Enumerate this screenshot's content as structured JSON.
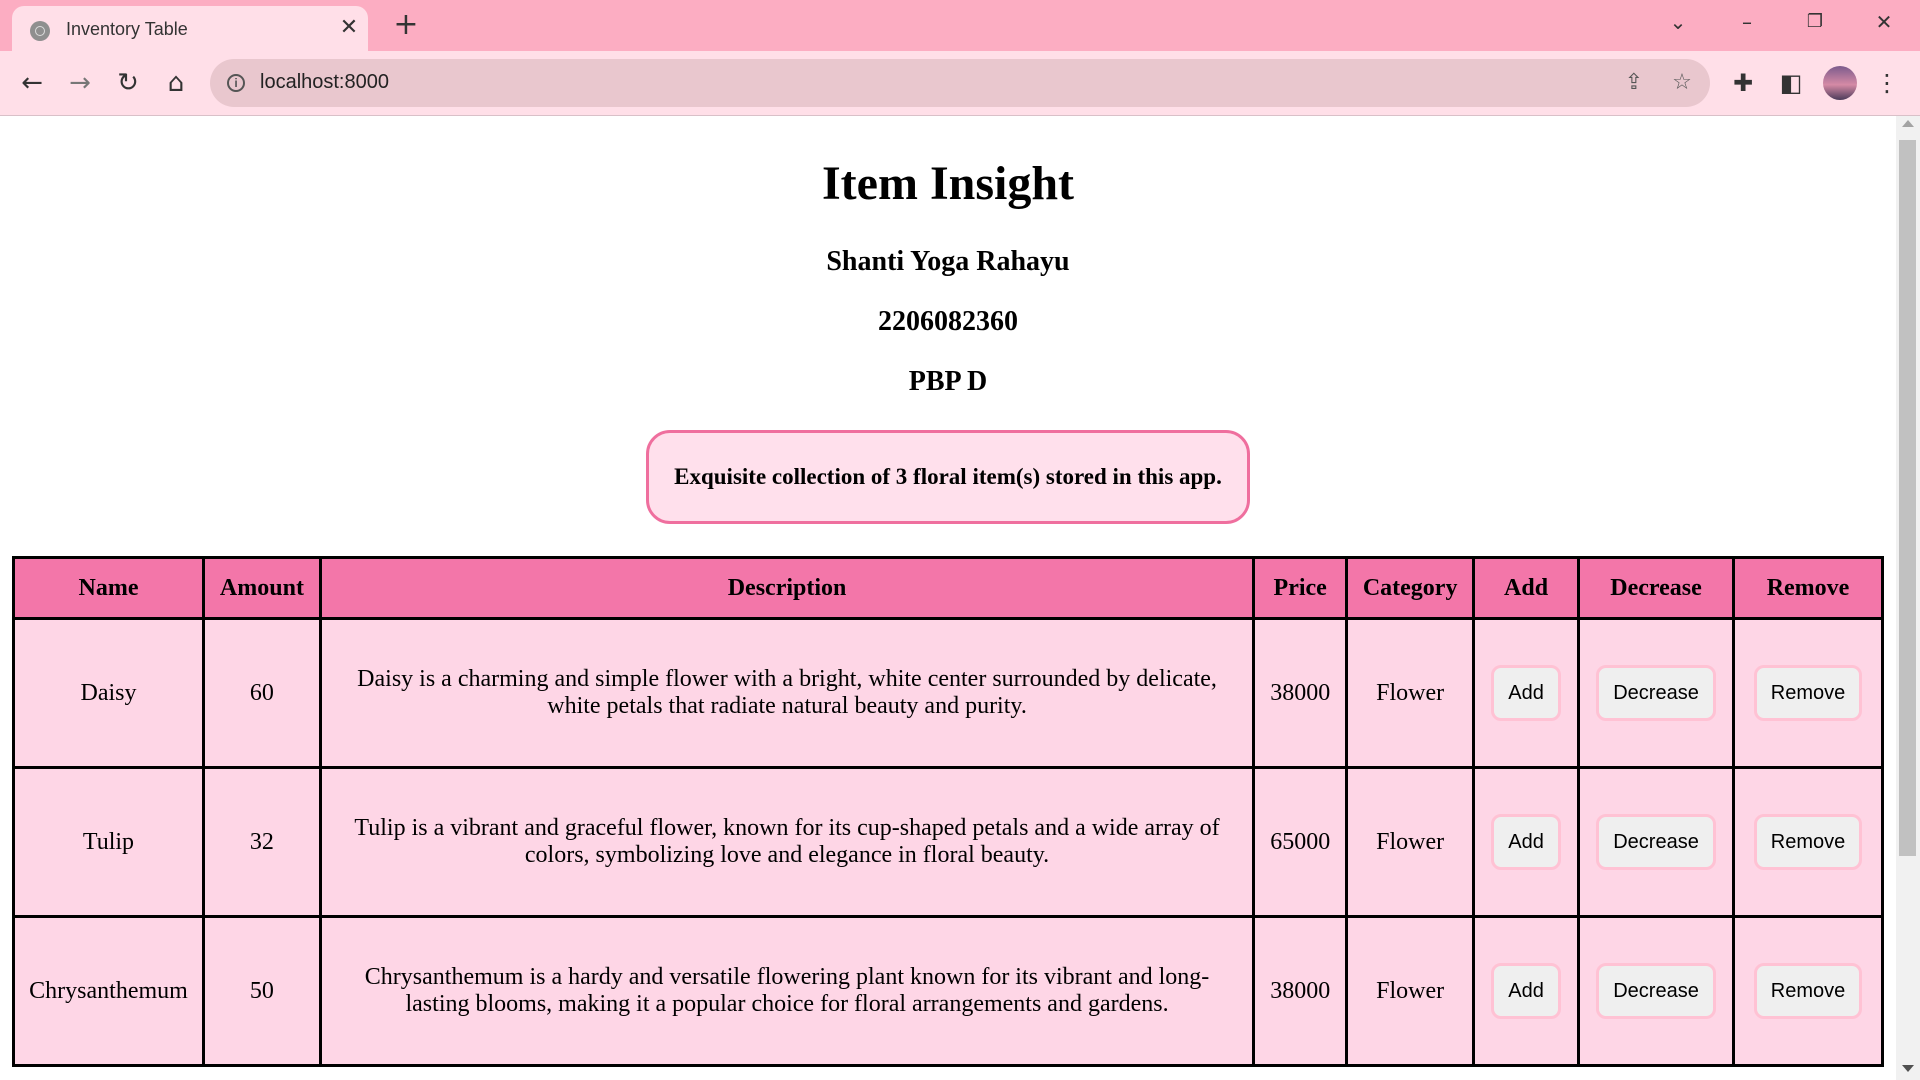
{
  "browser": {
    "tab_title": "Inventory Table",
    "url": "localhost:8000"
  },
  "page": {
    "title": "Item Insight",
    "name": "Shanti Yoga Rahayu",
    "npm": "2206082360",
    "class": "PBP D",
    "info": "Exquisite collection of 3 floral item(s) stored in this app."
  },
  "table": {
    "headers": [
      "Name",
      "Amount",
      "Description",
      "Price",
      "Category",
      "Add",
      "Decrease",
      "Remove"
    ],
    "rows": [
      {
        "name": "Daisy",
        "amount": "60",
        "description": "Daisy is a charming and simple flower with a bright, white center surrounded by delicate, white petals that radiate natural beauty and purity.",
        "price": "38000",
        "category": "Flower",
        "add": "Add",
        "decrease": "Decrease",
        "remove": "Remove"
      },
      {
        "name": "Tulip",
        "amount": "32",
        "description": "Tulip is a vibrant and graceful flower, known for its cup-shaped petals and a wide array of colors, symbolizing love and elegance in floral beauty.",
        "price": "65000",
        "category": "Flower",
        "add": "Add",
        "decrease": "Decrease",
        "remove": "Remove"
      },
      {
        "name": "Chrysanthemum",
        "amount": "50",
        "description": "Chrysanthemum is a hardy and versatile flowering plant known for its vibrant and long-lasting blooms, making it a popular choice for floral arrangements and gardens.",
        "price": "38000",
        "category": "Flower",
        "add": "Add",
        "decrease": "Decrease",
        "remove": "Remove"
      }
    ]
  },
  "colors": {
    "tab_strip": "#fcadc2",
    "toolbar": "#ffdfe8",
    "header_row": "#f376a9",
    "body_row": "#fed6e6",
    "info_border": "#ef6f9e"
  },
  "icons": [
    "globe-icon",
    "close-icon",
    "plus-icon",
    "chevron-down-icon",
    "minimize-icon",
    "restore-icon",
    "back-arrow-icon",
    "forward-arrow-icon",
    "reload-icon",
    "home-icon",
    "info-icon",
    "share-icon",
    "star-icon",
    "puzzle-icon",
    "sidepanel-icon",
    "kebab-menu-icon"
  ]
}
